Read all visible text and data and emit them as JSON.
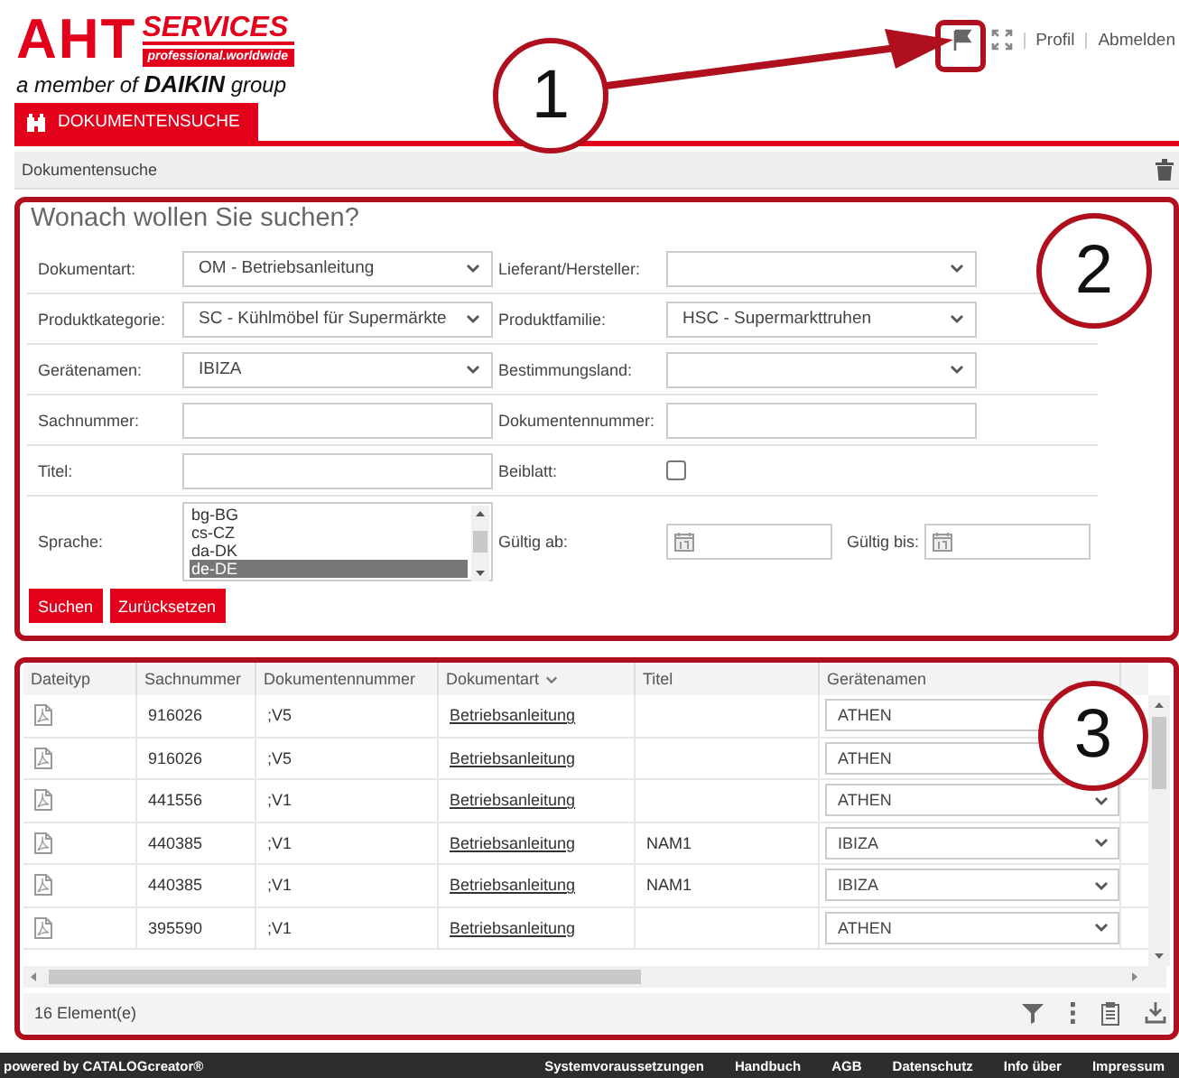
{
  "header": {
    "logo": {
      "brand": "AHT",
      "services": "SERVICES",
      "tagline": "professional.worldwide",
      "member_line": "a member of **DAIKIN** group"
    },
    "nav_links": [
      "Profil",
      "Abmelden"
    ]
  },
  "tabs": [
    {
      "label": "DOKUMENTENSUCHE",
      "selected": true
    }
  ],
  "breadcrumb": "Dokumentensuche",
  "search_form": {
    "title": "Wonach wollen Sie suchen?",
    "rows": [
      {
        "left": {
          "kind": "select",
          "label": "Dokumentart:",
          "value": "OM - Betriebsanleitung"
        },
        "right": {
          "kind": "select",
          "label": "Lieferant/Hersteller:"
        }
      },
      {
        "left": {
          "kind": "select",
          "label": "Produktkategorie:",
          "value": "SC - Kühlmöbel für Supermärkte"
        },
        "right": {
          "kind": "select",
          "label": "Produktfamilie:",
          "value": "HSC - Supermarkttruhen"
        }
      },
      {
        "left": {
          "kind": "select",
          "label": "Gerätenamen:",
          "value": "IBIZA"
        },
        "right": {
          "kind": "select",
          "label": "Bestimmungsland:"
        }
      },
      {
        "left": {
          "kind": "text",
          "label": "Sachnummer:"
        },
        "right": {
          "kind": "text",
          "label": "Dokumentennummer:"
        }
      },
      {
        "left": {
          "kind": "text",
          "label": "Titel:"
        },
        "right": {
          "kind": "checkbox",
          "label": "Beiblatt:",
          "checked": false
        }
      },
      {
        "left": {
          "kind": "listbox",
          "label": "Sprache:",
          "options": [
            {
              "label": "bg-BG",
              "selected": false
            },
            {
              "label": "cs-CZ",
              "selected": false
            },
            {
              "label": "da-DK",
              "selected": false
            },
            {
              "label": "de-DE",
              "selected": true
            }
          ]
        },
        "right": {
          "kind": "dates",
          "label": "Gültig ab:",
          "label_to": "Gültig bis:"
        }
      }
    ],
    "buttons": [
      "Suchen",
      "Zurücksetzen"
    ]
  },
  "results": {
    "columns": [
      {
        "label": "Dateityp",
        "sorted": false
      },
      {
        "label": "Sachnummer",
        "sorted": false
      },
      {
        "label": "Dokumentennummer",
        "sorted": false
      },
      {
        "label": "Dokumentart",
        "sorted": true
      },
      {
        "label": "Titel",
        "sorted": false
      },
      {
        "label": "Gerätenamen",
        "sorted": false
      }
    ],
    "rows": [
      {
        "sachnummer": "916026",
        "dokumentennummer": ";V5",
        "dokumentart": "Betriebsanleitung",
        "titel": "",
        "geraetenamen": "ATHEN"
      },
      {
        "sachnummer": "916026",
        "dokumentennummer": ";V5",
        "dokumentart": "Betriebsanleitung",
        "titel": "",
        "geraetenamen": "ATHEN"
      },
      {
        "sachnummer": "441556",
        "dokumentennummer": ";V1",
        "dokumentart": "Betriebsanleitung",
        "titel": "",
        "geraetenamen": "ATHEN"
      },
      {
        "sachnummer": "440385",
        "dokumentennummer": ";V1",
        "dokumentart": "Betriebsanleitung",
        "titel": "NAM1",
        "geraetenamen": "IBIZA"
      },
      {
        "sachnummer": "440385",
        "dokumentennummer": ";V1",
        "dokumentart": "Betriebsanleitung",
        "titel": "NAM1",
        "geraetenamen": "IBIZA"
      },
      {
        "sachnummer": "395590",
        "dokumentennummer": ";V1",
        "dokumentart": "Betriebsanleitung",
        "titel": "",
        "geraetenamen": "ATHEN"
      }
    ],
    "count": "16 Element(e)"
  },
  "footer": {
    "credit": "powered by CATALOGcreator®",
    "links": [
      "Systemvoraussetzungen",
      "Handbuch",
      "AGB",
      "Datenschutz",
      "Info über",
      "Impressum"
    ]
  },
  "callouts": [
    {
      "number": "1"
    },
    {
      "number": "2"
    },
    {
      "number": "3"
    }
  ]
}
